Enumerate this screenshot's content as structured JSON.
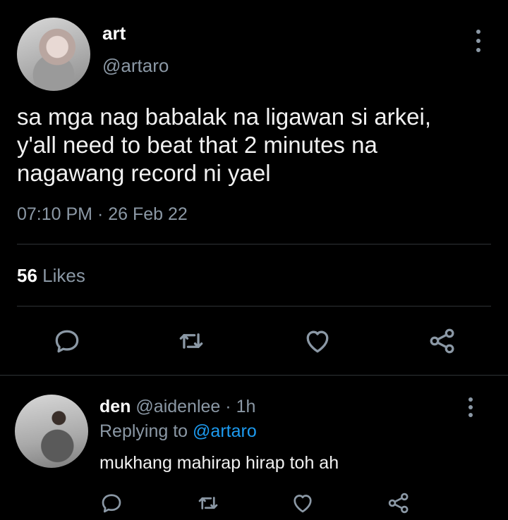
{
  "tweet": {
    "display_name": "art",
    "handle": "@artaro",
    "text_lines": [
      "sa mga nag babalak na ligawan si arkei,",
      "y'all need to beat that 2 minutes na",
      "nagawang record ni yael"
    ],
    "time": "07:10 PM",
    "separator": "·",
    "date": "26 Feb 22",
    "likes_count": "56",
    "likes_label": "Likes",
    "more_icon": "more-vertical-icon",
    "actions": [
      "reply-icon",
      "retweet-icon",
      "like-icon",
      "share-icon"
    ]
  },
  "reply": {
    "display_name": "den",
    "handle": "@aidenlee",
    "separator": "·",
    "age": "1h",
    "replying_to_label": "Replying to",
    "replying_to_handle": "@artaro",
    "text": "mukhang mahirap hirap toh ah",
    "more_icon": "more-vertical-icon",
    "actions": [
      "reply-icon",
      "retweet-icon",
      "like-icon",
      "share-icon"
    ]
  },
  "colors": {
    "background": "#000000",
    "text": "#e7e9ea",
    "secondary": "#8b98a5",
    "link": "#1d9bf0",
    "divider": "#2f3336"
  }
}
